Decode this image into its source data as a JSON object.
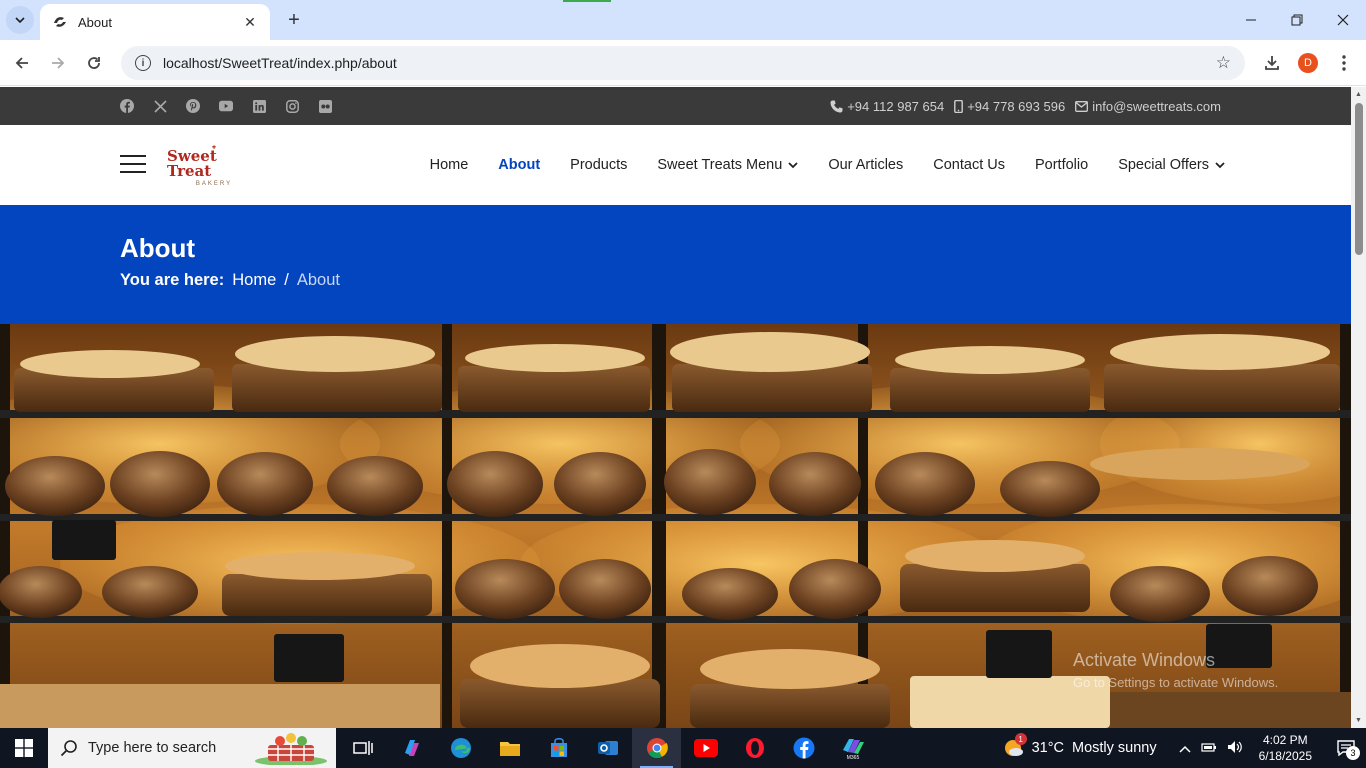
{
  "browser": {
    "tab_title": "About",
    "url": "localhost/SweetTreat/index.php/about",
    "profile_initial": "D"
  },
  "site": {
    "contacts": {
      "phone": "+94 112 987 654",
      "mobile": "+94 778 693 596",
      "email": "info@sweettreats.com"
    },
    "social": [
      "facebook-icon",
      "x-icon",
      "pinterest-icon",
      "youtube-icon",
      "linkedin-icon",
      "instagram-icon",
      "flickr-icon"
    ],
    "logo": {
      "name": "Sweet Treat",
      "tagline": "BAKERY"
    },
    "nav": [
      {
        "label": "Home"
      },
      {
        "label": "About",
        "active": true
      },
      {
        "label": "Products"
      },
      {
        "label": "Sweet Treats Menu",
        "dropdown": true
      },
      {
        "label": "Our Articles"
      },
      {
        "label": "Contact Us"
      },
      {
        "label": "Portfolio"
      },
      {
        "label": "Special Offers",
        "dropdown": true
      }
    ],
    "hero": {
      "title": "About",
      "breadcrumb_prefix": "You are here:",
      "breadcrumb_home": "Home",
      "breadcrumb_sep": "/",
      "breadcrumb_current": "About"
    },
    "colors": {
      "accent": "#0345bf",
      "topbar": "#3a3a3a"
    }
  },
  "overlay": {
    "watermark_title": "Activate Windows",
    "watermark_sub": "Go to Settings to activate Windows."
  },
  "taskbar": {
    "search_placeholder": "Type here to search",
    "weather_temp": "31°C",
    "weather_text": "Mostly sunny",
    "time": "4:02 PM",
    "date": "6/18/2025",
    "notification_count": "3",
    "weather_badge": "1"
  }
}
